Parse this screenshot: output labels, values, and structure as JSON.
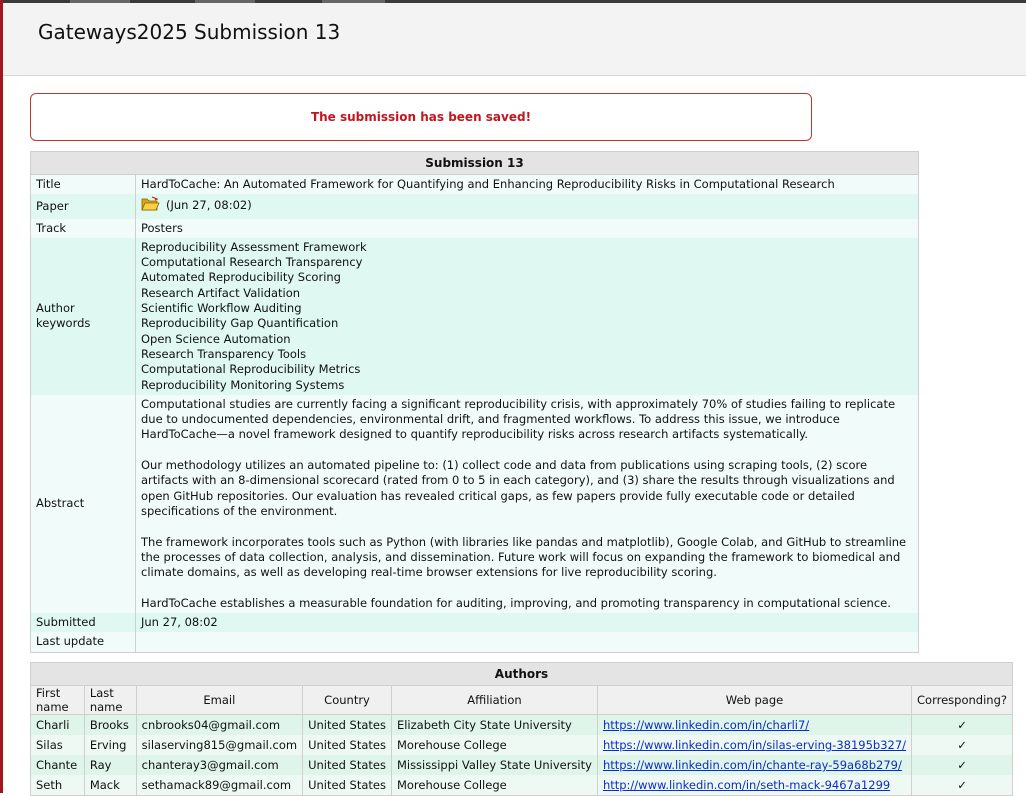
{
  "header": {
    "title": "Gateways2025 Submission 13"
  },
  "notice": {
    "text": "The submission has been saved!"
  },
  "submission": {
    "caption": "Submission 13",
    "title_label": "Title",
    "title_value": "HardToCache: An Automated Framework for Quantifying and Enhancing Reproducibility Risks in Computational Research",
    "paper_label": "Paper",
    "paper_icon": "folder-icon",
    "paper_value": "(Jun 27, 08:02)",
    "track_label": "Track",
    "track_value": "Posters",
    "keywords_label": "Author keywords",
    "keywords": [
      "Reproducibility Assessment Framework",
      "Computational Research Transparency",
      "Automated Reproducibility Scoring",
      "Research Artifact Validation",
      "Scientific Workflow Auditing",
      "Reproducibility Gap Quantification",
      "Open Science Automation",
      "Research Transparency Tools",
      "Computational Reproducibility Metrics",
      "Reproducibility Monitoring Systems"
    ],
    "abstract_label": "Abstract",
    "abstract": [
      "Computational studies are currently facing a significant reproducibility crisis, with approximately 70% of studies failing to replicate due to undocumented dependencies, environmental drift, and fragmented workflows. To address this issue, we introduce HardToCache—a novel framework designed to quantify reproducibility risks across research artifacts systematically.",
      "Our methodology utilizes an automated pipeline to: (1) collect code and data from publications using scraping tools, (2) score artifacts with an 8-dimensional scorecard (rated from 0 to 5 in each category), and (3) share the results through visualizations and open GitHub repositories. Our evaluation has revealed critical gaps, as few papers provide fully executable code or detailed specifications of the environment.",
      "The framework incorporates tools such as Python (with libraries like pandas and matplotlib), Google Colab, and GitHub to streamline the processes of data collection, analysis, and dissemination. Future work will focus on expanding the framework to biomedical and climate domains, as well as developing real-time browser extensions for live reproducibility scoring.",
      "HardToCache establishes a measurable foundation for auditing, improving, and promoting transparency in computational science."
    ],
    "submitted_label": "Submitted",
    "submitted_value": "Jun 27, 08:02",
    "updated_label": "Last update",
    "updated_value": ""
  },
  "authors": {
    "caption": "Authors",
    "columns": [
      "First name",
      "Last name",
      "Email",
      "Country",
      "Affiliation",
      "Web page",
      "Corresponding?"
    ],
    "rows": [
      {
        "first": "Charli",
        "last": "Brooks",
        "email": "cnbrooks04@gmail.com",
        "country": "United States",
        "affiliation": "Elizabeth City State University",
        "web": "https://www.linkedin.com/in/charli7/",
        "corresponding": "✓"
      },
      {
        "first": "Silas",
        "last": "Erving",
        "email": "silaserving815@gmail.com",
        "country": "United States",
        "affiliation": "Morehouse College",
        "web": "https://www.linkedin.com/in/silas-erving-38195b327/",
        "corresponding": "✓"
      },
      {
        "first": "Chante",
        "last": "Ray",
        "email": "chanteray3@gmail.com",
        "country": "United States",
        "affiliation": "Mississippi Valley State University",
        "web": "https://www.linkedin.com/in/chante-ray-59a68b279/",
        "corresponding": "✓"
      },
      {
        "first": "Seth",
        "last": "Mack",
        "email": "sethamack89@gmail.com",
        "country": "United States",
        "affiliation": "Morehouse College",
        "web": "http://www.linkedin.com/in/seth-mack-9467a1299",
        "corresponding": "✓"
      }
    ]
  }
}
